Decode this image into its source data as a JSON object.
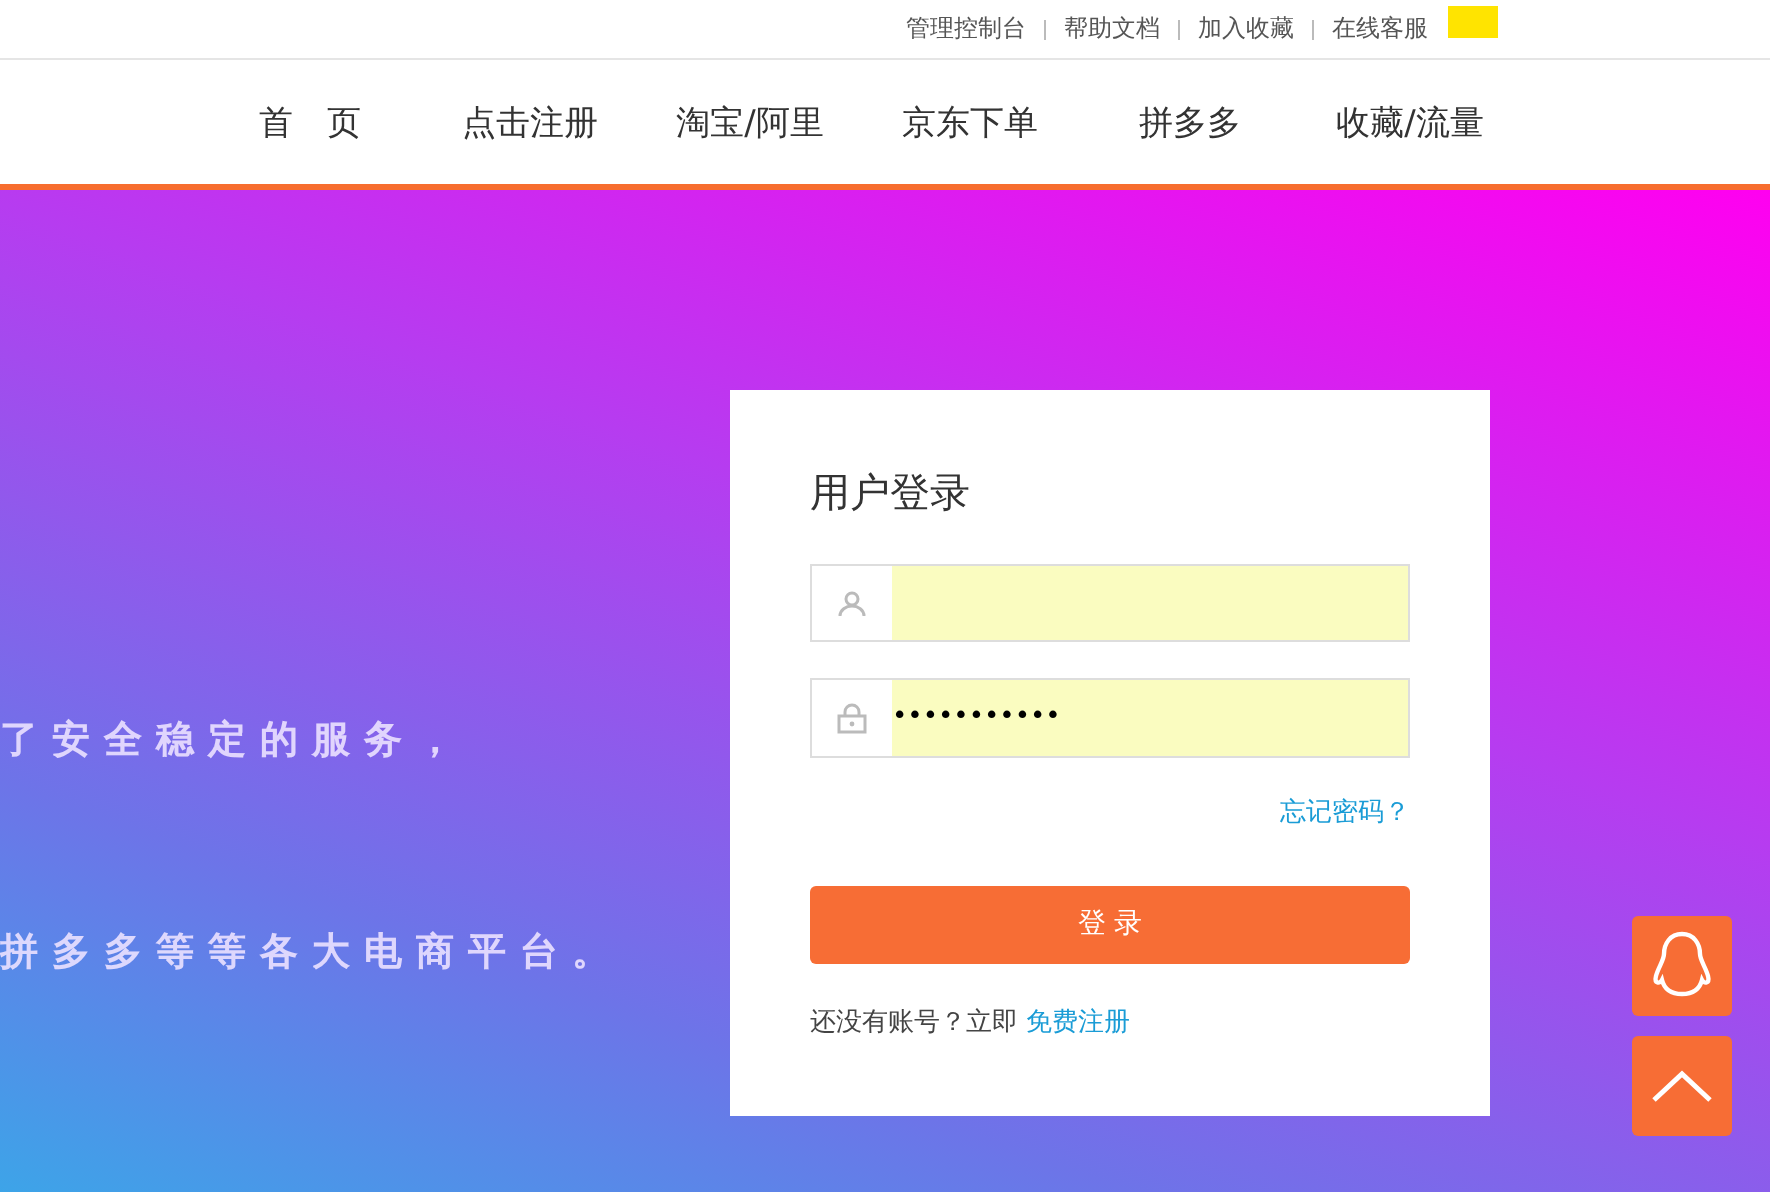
{
  "top_links": [
    "管理控制台",
    "帮助文档",
    "加入收藏",
    "在线客服"
  ],
  "nav": [
    "首　页",
    "点击注册",
    "淘宝/阿里",
    "京东下单",
    "拼多多",
    "收藏/流量"
  ],
  "hero_lines": [
    "了安全稳定的服务，",
    "拼多多等等各大电商平台。"
  ],
  "login": {
    "title": "用户登录",
    "password": "•••••••••••",
    "forgot": "忘记密码？",
    "submit": "登 录",
    "signup_prompt": "还没有账号？立即",
    "signup_link": "免费注册"
  }
}
